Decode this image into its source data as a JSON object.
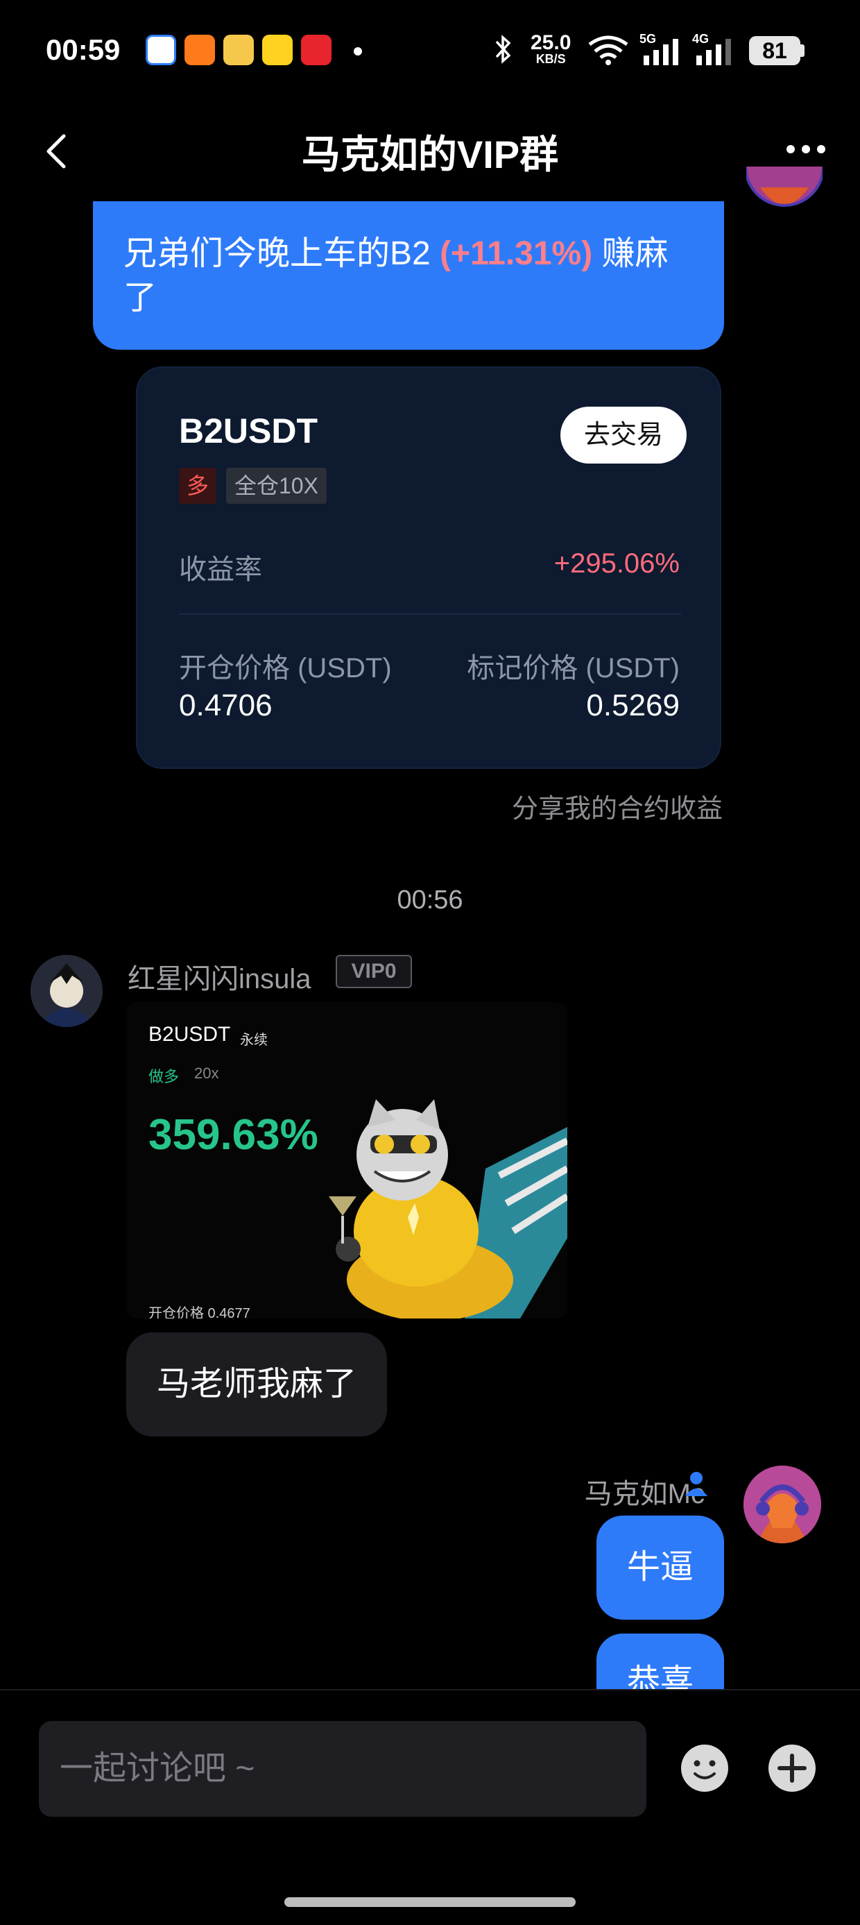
{
  "status_bar": {
    "time": "00:59",
    "net_speed": "25.0",
    "net_unit": "KB/S",
    "net_5g": "5G",
    "net_4g": "4G",
    "battery": "81"
  },
  "header": {
    "title": "马克如的VIP群"
  },
  "messages": {
    "top_text_a": "兄弟们今晚上车的B2 ",
    "top_text_pct": "(+11.31%)",
    "top_text_b": " 赚麻了",
    "card": {
      "pair": "B2USDT",
      "trade_btn": "去交易",
      "side": "多",
      "leverage": "全仓10X",
      "roi_label": "收益率",
      "roi_value": "+295.06%",
      "open_label": "开仓价格 (USDT)",
      "open_value": "0.4706",
      "mark_label": "标记价格 (USDT)",
      "mark_value": "0.5269"
    },
    "share_text": "分享我的合约收益",
    "timestamp": "00:56",
    "incoming": {
      "sender": "红星闪闪insula",
      "vip": "VIP0",
      "image": {
        "pair": "B2USDT",
        "perp": "永续",
        "side": "做多",
        "lev": "20x",
        "roi": "359.63%",
        "open": "开仓价格 0.4677"
      },
      "text": "马老师我麻了"
    },
    "outgoing": {
      "sender": "马克如Mc",
      "text1": "牛逼",
      "text2": "恭喜"
    }
  },
  "input": {
    "placeholder": "一起讨论吧 ~"
  },
  "colors": {
    "accent_blue": "#2e7bfa",
    "profit_red": "#ff6b7d",
    "profit_green": "#27c58a"
  }
}
